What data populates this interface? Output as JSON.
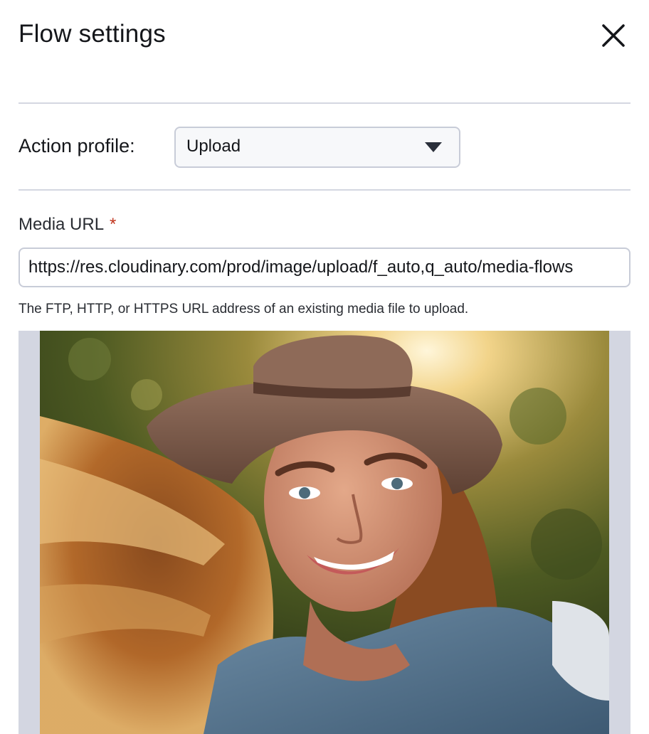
{
  "dialog": {
    "title": "Flow settings",
    "close_icon": "close-icon"
  },
  "profile": {
    "label": "Action profile:",
    "selected": "Upload",
    "caret_icon": "caret-down-icon"
  },
  "media_url": {
    "label": "Media URL",
    "required_mark": "*",
    "value": "https://res.cloudinary.com/prod/image/upload/f_auto,q_auto/media-flows",
    "helper": "The FTP, HTTP, or HTTPS URL address of an existing media file to upload."
  },
  "preview": {
    "alt": "Media preview"
  },
  "colors": {
    "divider": "#d4d7e1",
    "border": "#c8ccd8",
    "required": "#c0341d",
    "preview_bg": "#d3d6e1"
  }
}
